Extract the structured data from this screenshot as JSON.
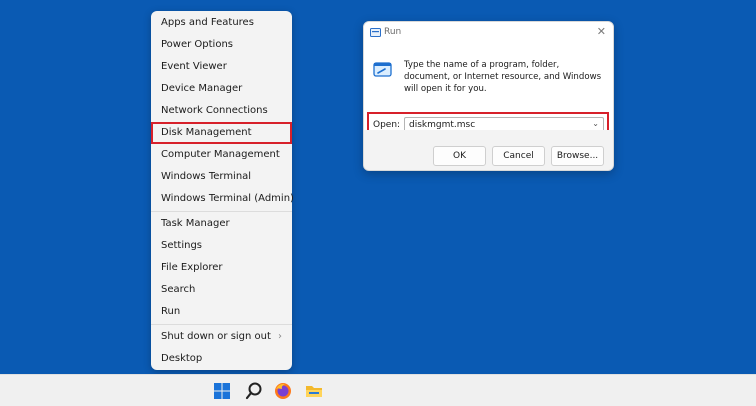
{
  "winx_menu": {
    "group1": [
      "Apps and Features",
      "Power Options",
      "Event Viewer",
      "Device Manager",
      "Network Connections",
      "Disk Management",
      "Computer Management",
      "Windows Terminal",
      "Windows Terminal (Admin)"
    ],
    "group2": [
      "Task Manager",
      "Settings",
      "File Explorer",
      "Search",
      "Run"
    ],
    "group3": [
      "Shut down or sign out",
      "Desktop"
    ],
    "highlighted_item": "Disk Management"
  },
  "run_dialog": {
    "title": "Run",
    "close_glyph": "✕",
    "description": "Type the name of a program, folder, document, or Internet resource, and Windows will open it for you.",
    "open_label": "Open:",
    "open_value": "diskmgmt.msc",
    "ok_label": "OK",
    "cancel_label": "Cancel",
    "browse_label": "Browse..."
  },
  "taskbar": {
    "icons": [
      "windows-start-icon",
      "search-icon",
      "firefox-icon",
      "file-explorer-icon"
    ]
  },
  "colors": {
    "desktop": "#0a5ab3",
    "highlight_border": "#d7202a",
    "menu_bg": "#f3f3f3"
  }
}
